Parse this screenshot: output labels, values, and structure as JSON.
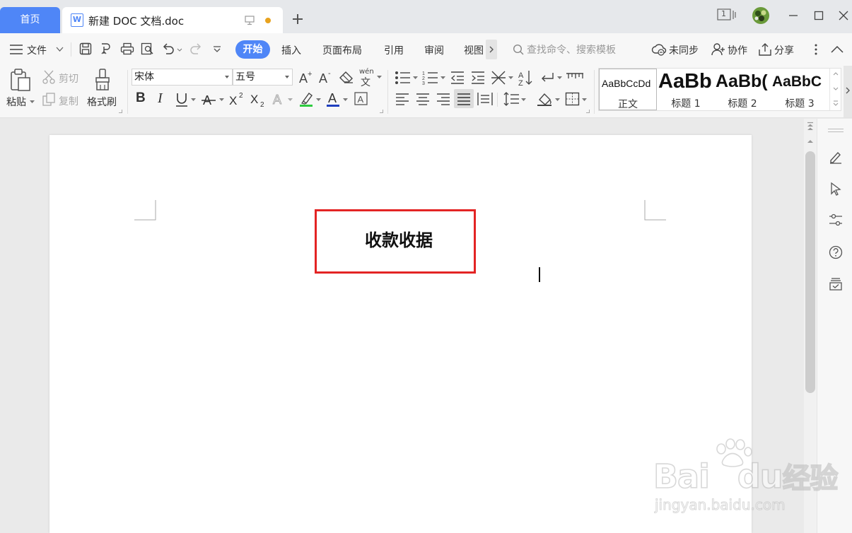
{
  "tabs": {
    "home": "首页",
    "doc_title": "新建 DOC 文档.doc"
  },
  "window": {
    "badge": "1"
  },
  "menubar": {
    "file": "文件",
    "items": [
      "开始",
      "插入",
      "页面布局",
      "引用",
      "审阅",
      "视图"
    ],
    "search_placeholder": "查找命令、搜索模板",
    "sync": "未同步",
    "collab": "协作",
    "share": "分享"
  },
  "ribbon": {
    "paste": "粘贴",
    "cut": "剪切",
    "copy": "复制",
    "format_painter": "格式刷",
    "font_name": "宋体",
    "font_size": "五号",
    "pinyin": "wén",
    "styles": [
      {
        "sample": "AaBbCcDd",
        "name": "正文"
      },
      {
        "sample": "AaBb",
        "name": "标题 1"
      },
      {
        "sample": "AaBb(",
        "name": "标题 2"
      },
      {
        "sample": "AaBbC",
        "name": "标题 3"
      }
    ]
  },
  "document": {
    "heading": "收款收据"
  },
  "colors": {
    "accent": "#4f86f7",
    "highlight": "#2ecc40",
    "font_color": "#1f3fbf",
    "annotation": "#e32424",
    "unsaved_dot": "#e8a21e"
  },
  "watermark": {
    "brand": "Bai",
    "brand_suffix": "du",
    "brand_cn": "经验",
    "url": "jingyan.baidu.com"
  }
}
